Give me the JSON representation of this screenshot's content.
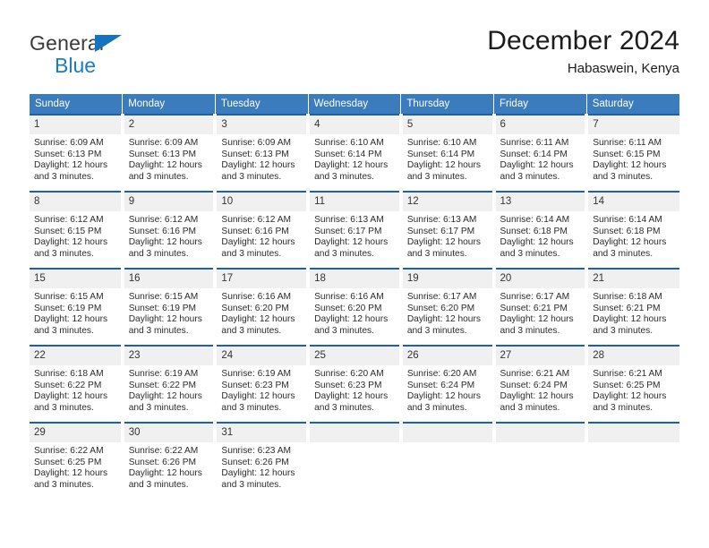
{
  "brand": {
    "name_top": "General",
    "name_bottom": "Blue",
    "triangle_color": "#1673bd",
    "blue_text_color": "#1b7bc4"
  },
  "header": {
    "title": "December 2024",
    "location": "Habaswein, Kenya"
  },
  "colors": {
    "header_blue": "#3b7cbf",
    "row_rule": "#1f5ea8",
    "day_band": "#f0f0f0"
  },
  "calendar": {
    "weekdays": [
      "Sunday",
      "Monday",
      "Tuesday",
      "Wednesday",
      "Thursday",
      "Friday",
      "Saturday"
    ],
    "weeks": [
      [
        {
          "day": "1",
          "sunrise": "Sunrise: 6:09 AM",
          "sunset": "Sunset: 6:13 PM",
          "daylight": "Daylight: 12 hours and 3 minutes."
        },
        {
          "day": "2",
          "sunrise": "Sunrise: 6:09 AM",
          "sunset": "Sunset: 6:13 PM",
          "daylight": "Daylight: 12 hours and 3 minutes."
        },
        {
          "day": "3",
          "sunrise": "Sunrise: 6:09 AM",
          "sunset": "Sunset: 6:13 PM",
          "daylight": "Daylight: 12 hours and 3 minutes."
        },
        {
          "day": "4",
          "sunrise": "Sunrise: 6:10 AM",
          "sunset": "Sunset: 6:14 PM",
          "daylight": "Daylight: 12 hours and 3 minutes."
        },
        {
          "day": "5",
          "sunrise": "Sunrise: 6:10 AM",
          "sunset": "Sunset: 6:14 PM",
          "daylight": "Daylight: 12 hours and 3 minutes."
        },
        {
          "day": "6",
          "sunrise": "Sunrise: 6:11 AM",
          "sunset": "Sunset: 6:14 PM",
          "daylight": "Daylight: 12 hours and 3 minutes."
        },
        {
          "day": "7",
          "sunrise": "Sunrise: 6:11 AM",
          "sunset": "Sunset: 6:15 PM",
          "daylight": "Daylight: 12 hours and 3 minutes."
        }
      ],
      [
        {
          "day": "8",
          "sunrise": "Sunrise: 6:12 AM",
          "sunset": "Sunset: 6:15 PM",
          "daylight": "Daylight: 12 hours and 3 minutes."
        },
        {
          "day": "9",
          "sunrise": "Sunrise: 6:12 AM",
          "sunset": "Sunset: 6:16 PM",
          "daylight": "Daylight: 12 hours and 3 minutes."
        },
        {
          "day": "10",
          "sunrise": "Sunrise: 6:12 AM",
          "sunset": "Sunset: 6:16 PM",
          "daylight": "Daylight: 12 hours and 3 minutes."
        },
        {
          "day": "11",
          "sunrise": "Sunrise: 6:13 AM",
          "sunset": "Sunset: 6:17 PM",
          "daylight": "Daylight: 12 hours and 3 minutes."
        },
        {
          "day": "12",
          "sunrise": "Sunrise: 6:13 AM",
          "sunset": "Sunset: 6:17 PM",
          "daylight": "Daylight: 12 hours and 3 minutes."
        },
        {
          "day": "13",
          "sunrise": "Sunrise: 6:14 AM",
          "sunset": "Sunset: 6:18 PM",
          "daylight": "Daylight: 12 hours and 3 minutes."
        },
        {
          "day": "14",
          "sunrise": "Sunrise: 6:14 AM",
          "sunset": "Sunset: 6:18 PM",
          "daylight": "Daylight: 12 hours and 3 minutes."
        }
      ],
      [
        {
          "day": "15",
          "sunrise": "Sunrise: 6:15 AM",
          "sunset": "Sunset: 6:19 PM",
          "daylight": "Daylight: 12 hours and 3 minutes."
        },
        {
          "day": "16",
          "sunrise": "Sunrise: 6:15 AM",
          "sunset": "Sunset: 6:19 PM",
          "daylight": "Daylight: 12 hours and 3 minutes."
        },
        {
          "day": "17",
          "sunrise": "Sunrise: 6:16 AM",
          "sunset": "Sunset: 6:20 PM",
          "daylight": "Daylight: 12 hours and 3 minutes."
        },
        {
          "day": "18",
          "sunrise": "Sunrise: 6:16 AM",
          "sunset": "Sunset: 6:20 PM",
          "daylight": "Daylight: 12 hours and 3 minutes."
        },
        {
          "day": "19",
          "sunrise": "Sunrise: 6:17 AM",
          "sunset": "Sunset: 6:20 PM",
          "daylight": "Daylight: 12 hours and 3 minutes."
        },
        {
          "day": "20",
          "sunrise": "Sunrise: 6:17 AM",
          "sunset": "Sunset: 6:21 PM",
          "daylight": "Daylight: 12 hours and 3 minutes."
        },
        {
          "day": "21",
          "sunrise": "Sunrise: 6:18 AM",
          "sunset": "Sunset: 6:21 PM",
          "daylight": "Daylight: 12 hours and 3 minutes."
        }
      ],
      [
        {
          "day": "22",
          "sunrise": "Sunrise: 6:18 AM",
          "sunset": "Sunset: 6:22 PM",
          "daylight": "Daylight: 12 hours and 3 minutes."
        },
        {
          "day": "23",
          "sunrise": "Sunrise: 6:19 AM",
          "sunset": "Sunset: 6:22 PM",
          "daylight": "Daylight: 12 hours and 3 minutes."
        },
        {
          "day": "24",
          "sunrise": "Sunrise: 6:19 AM",
          "sunset": "Sunset: 6:23 PM",
          "daylight": "Daylight: 12 hours and 3 minutes."
        },
        {
          "day": "25",
          "sunrise": "Sunrise: 6:20 AM",
          "sunset": "Sunset: 6:23 PM",
          "daylight": "Daylight: 12 hours and 3 minutes."
        },
        {
          "day": "26",
          "sunrise": "Sunrise: 6:20 AM",
          "sunset": "Sunset: 6:24 PM",
          "daylight": "Daylight: 12 hours and 3 minutes."
        },
        {
          "day": "27",
          "sunrise": "Sunrise: 6:21 AM",
          "sunset": "Sunset: 6:24 PM",
          "daylight": "Daylight: 12 hours and 3 minutes."
        },
        {
          "day": "28",
          "sunrise": "Sunrise: 6:21 AM",
          "sunset": "Sunset: 6:25 PM",
          "daylight": "Daylight: 12 hours and 3 minutes."
        }
      ],
      [
        {
          "day": "29",
          "sunrise": "Sunrise: 6:22 AM",
          "sunset": "Sunset: 6:25 PM",
          "daylight": "Daylight: 12 hours and 3 minutes."
        },
        {
          "day": "30",
          "sunrise": "Sunrise: 6:22 AM",
          "sunset": "Sunset: 6:26 PM",
          "daylight": "Daylight: 12 hours and 3 minutes."
        },
        {
          "day": "31",
          "sunrise": "Sunrise: 6:23 AM",
          "sunset": "Sunset: 6:26 PM",
          "daylight": "Daylight: 12 hours and 3 minutes."
        },
        {
          "day": "",
          "sunrise": "",
          "sunset": "",
          "daylight": ""
        },
        {
          "day": "",
          "sunrise": "",
          "sunset": "",
          "daylight": ""
        },
        {
          "day": "",
          "sunrise": "",
          "sunset": "",
          "daylight": ""
        },
        {
          "day": "",
          "sunrise": "",
          "sunset": "",
          "daylight": ""
        }
      ]
    ]
  }
}
